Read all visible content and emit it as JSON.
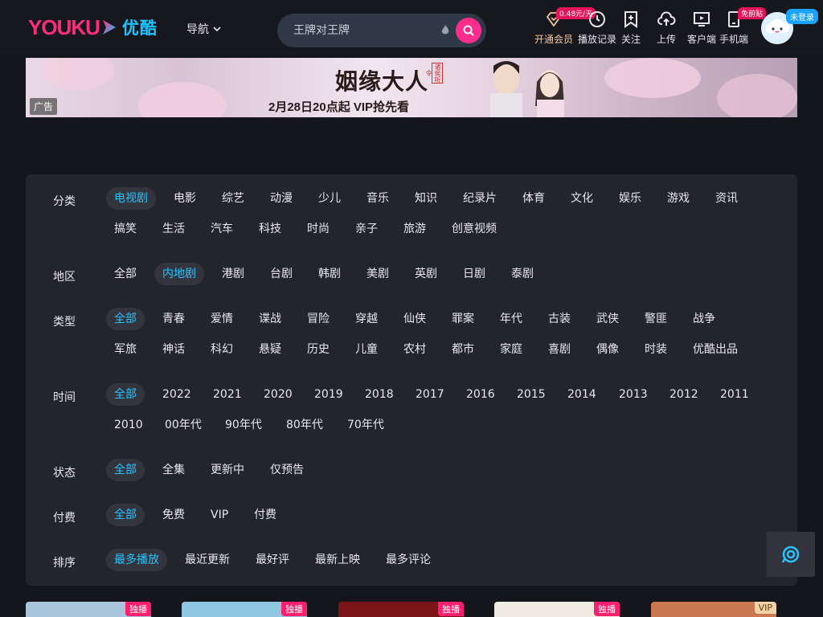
{
  "header": {
    "logo_text": "YOUKU",
    "logo_cn": "优酷",
    "nav_label": "导航",
    "search_placeholder": "王牌对王牌",
    "items": [
      {
        "label": "开通会员",
        "badge": "0.48元/天",
        "icon": "diamond-icon"
      },
      {
        "label": "播放记录",
        "icon": "clock-icon"
      },
      {
        "label": "关注",
        "icon": "bookmark-plus-icon"
      },
      {
        "label": "上传",
        "icon": "cloud-upload-icon"
      },
      {
        "label": "客户端",
        "icon": "monitor-icon"
      },
      {
        "label": "手机端",
        "badge": "免前贴",
        "icon": "phone-icon"
      }
    ],
    "login_badge": "未登录"
  },
  "ad": {
    "title": "姻缘大人",
    "seal": "诸侯听令",
    "subtitle": "2月28日20点起 VIP抢先看",
    "tag": "广告"
  },
  "filters": [
    {
      "label": "分类",
      "options": [
        "电视剧",
        "电影",
        "综艺",
        "动漫",
        "少儿",
        "音乐",
        "知识",
        "纪录片",
        "体育",
        "文化",
        "娱乐",
        "游戏",
        "资讯",
        "搞笑",
        "生活",
        "汽车",
        "科技",
        "时尚",
        "亲子",
        "旅游",
        "创意视频"
      ],
      "active": "电视剧"
    },
    {
      "label": "地区",
      "options": [
        "全部",
        "内地剧",
        "港剧",
        "台剧",
        "韩剧",
        "美剧",
        "英剧",
        "日剧",
        "泰剧"
      ],
      "active": "内地剧"
    },
    {
      "label": "类型",
      "options": [
        "全部",
        "青春",
        "爱情",
        "谍战",
        "冒险",
        "穿越",
        "仙侠",
        "罪案",
        "年代",
        "古装",
        "武侠",
        "警匪",
        "战争",
        "军旅",
        "神话",
        "科幻",
        "悬疑",
        "历史",
        "儿童",
        "农村",
        "都市",
        "家庭",
        "喜剧",
        "偶像",
        "时装",
        "优酷出品"
      ],
      "active": "全部"
    },
    {
      "label": "时间",
      "options": [
        "全部",
        "2022",
        "2021",
        "2020",
        "2019",
        "2018",
        "2017",
        "2016",
        "2015",
        "2014",
        "2013",
        "2012",
        "2011",
        "2010",
        "00年代",
        "90年代",
        "80年代",
        "70年代"
      ],
      "active": "全部"
    },
    {
      "label": "状态",
      "options": [
        "全部",
        "全集",
        "更新中",
        "仅预告"
      ],
      "active": "全部"
    },
    {
      "label": "付费",
      "options": [
        "全部",
        "免费",
        "VIP",
        "付费"
      ],
      "active": "全部"
    },
    {
      "label": "排序",
      "options": [
        "最多播放",
        "最近更新",
        "最好评",
        "最新上映",
        "最多评论"
      ],
      "active": "最多播放"
    }
  ],
  "cards": [
    {
      "tag": "独播",
      "color": "#a9c6dc"
    },
    {
      "tag": "独播",
      "color": "#8fc7e0"
    },
    {
      "tag": "独播",
      "color": "#7a1418"
    },
    {
      "tag": "独播",
      "color": "#f1ece2"
    },
    {
      "tag": "VIP",
      "color": "#c97850"
    }
  ]
}
